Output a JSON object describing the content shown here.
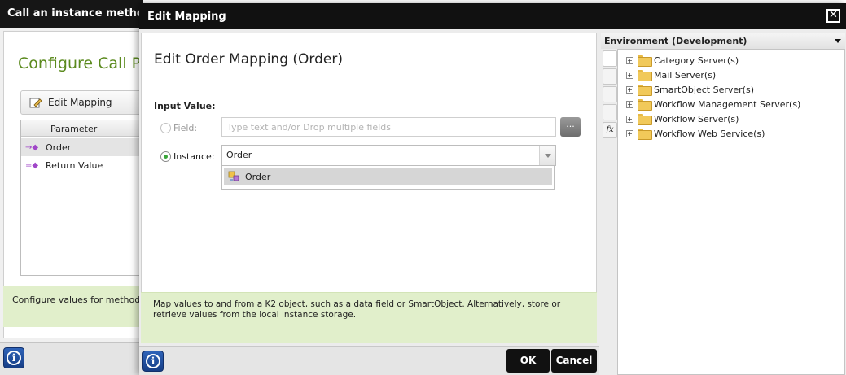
{
  "background_dialog": {
    "title": "Call an instance method",
    "heading": "Configure Call P",
    "toolbar_button": "Edit Mapping",
    "grid_header": "Parameter",
    "rows": [
      {
        "label": "Order",
        "icon": "input-parameter-icon"
      },
      {
        "label": "Return Value",
        "icon": "return-parameter-icon"
      }
    ],
    "hint": "Configure values for method ca"
  },
  "edit_mapping": {
    "title": "Edit Mapping",
    "heading": "Edit Order Mapping (Order)",
    "input_value_label": "Input Value:",
    "field_label": "Field:",
    "field_placeholder": "Type text and/or Drop multiple fields",
    "browse_label": "...",
    "instance_label": "Instance:",
    "instance_value": "Order",
    "dropdown_item": "Order",
    "help_text": "Map values to and from a K2 object, such as a data field or SmartObject. Alternatively, store or retrieve values from the local instance storage.",
    "ok_label": "OK",
    "cancel_label": "Cancel"
  },
  "environment": {
    "title": "Environment (Development)",
    "tree": [
      "Category Server(s)",
      "Mail Server(s)",
      "SmartObject Server(s)",
      "Workflow Management Server(s)",
      "Workflow Server(s)",
      "Workflow Web Service(s)"
    ]
  },
  "colors": {
    "accent_green": "#5b8a1e",
    "help_background": "#e1efcb",
    "titlebar": "#111111",
    "info_blue": "#1f4fa3"
  }
}
